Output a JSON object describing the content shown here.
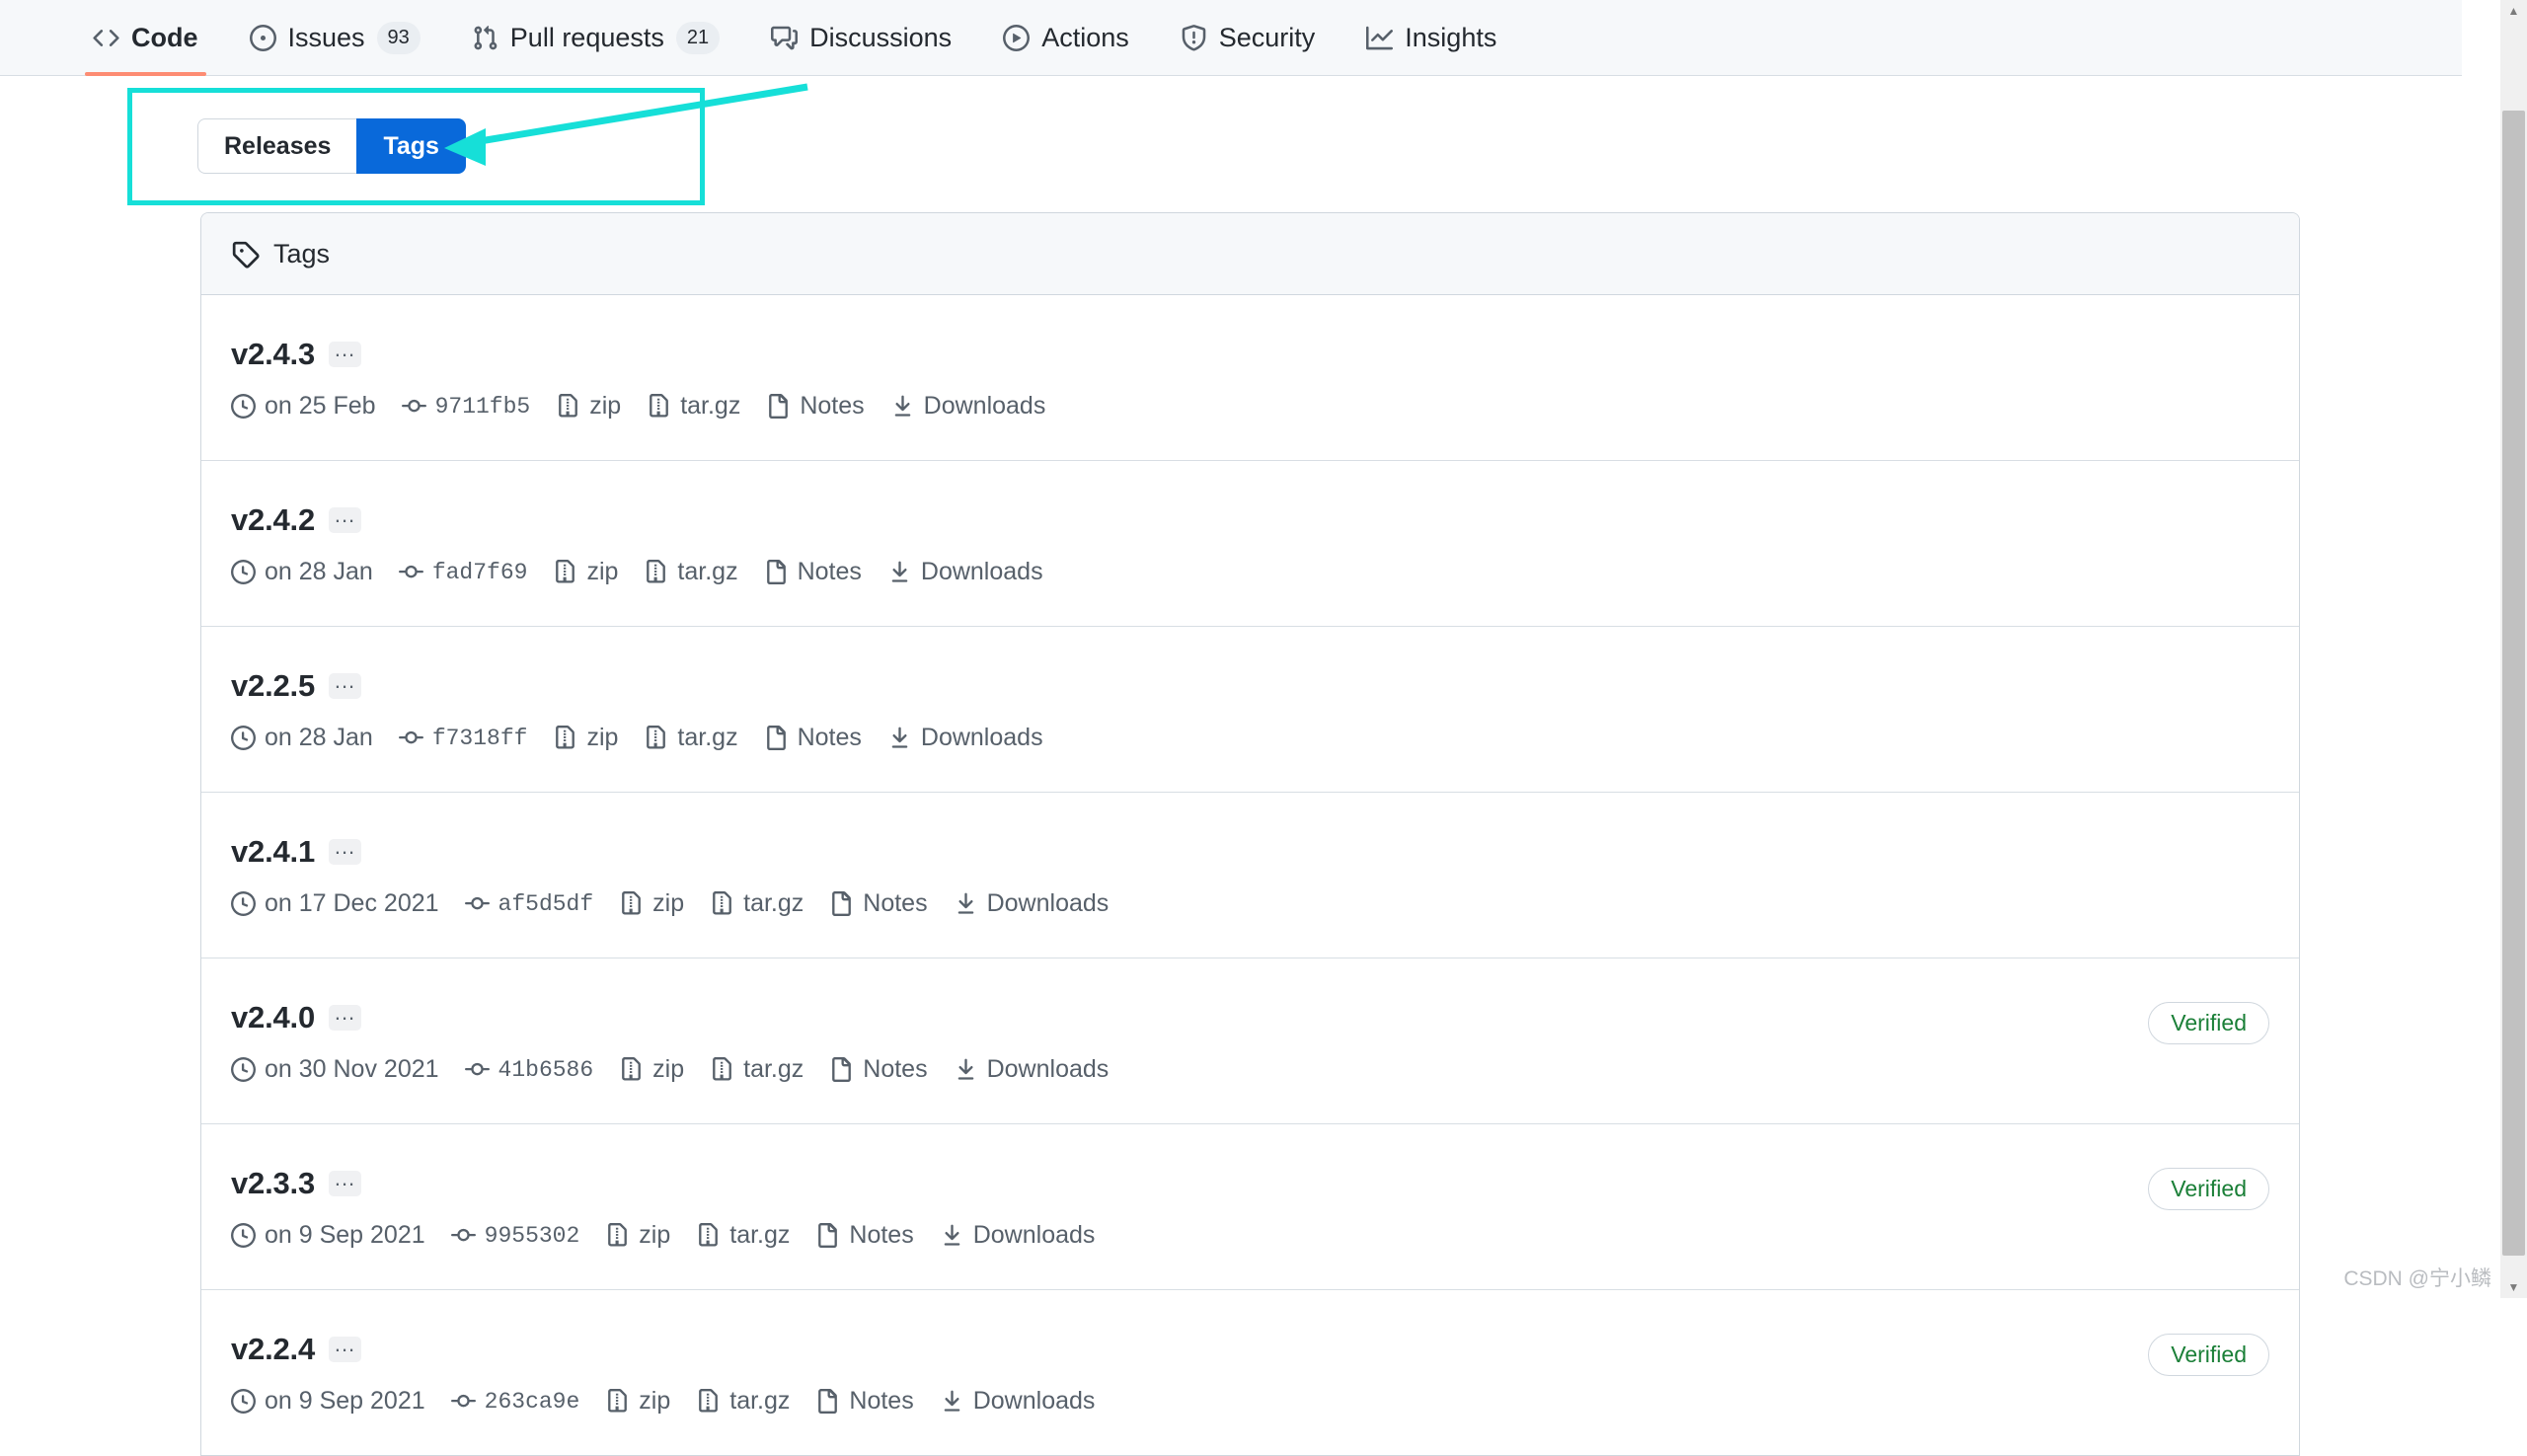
{
  "repo_nav": {
    "items": [
      {
        "label": "Code",
        "icon": "code-icon",
        "count": null,
        "selected": true
      },
      {
        "label": "Issues",
        "icon": "issue-opened-icon",
        "count": "93",
        "selected": false
      },
      {
        "label": "Pull requests",
        "icon": "git-pull-request-icon",
        "count": "21",
        "selected": false
      },
      {
        "label": "Discussions",
        "icon": "comment-discussion-icon",
        "count": null,
        "selected": false
      },
      {
        "label": "Actions",
        "icon": "play-icon",
        "count": null,
        "selected": false
      },
      {
        "label": "Security",
        "icon": "shield-icon",
        "count": null,
        "selected": false
      },
      {
        "label": "Insights",
        "icon": "graph-icon",
        "count": null,
        "selected": false
      }
    ],
    "selected_underline_color": "#fd8c73"
  },
  "toggle": {
    "releases_label": "Releases",
    "tags_label": "Tags",
    "active": "Tags",
    "active_color": "#0969da"
  },
  "annotation": {
    "color": "#16dfd8",
    "shape": "rectangle-with-arrow",
    "points_to": "Tags"
  },
  "panel": {
    "header_label": "Tags",
    "header_icon": "tag-icon",
    "meta_labels": {
      "zip": "zip",
      "targz": "tar.gz",
      "notes": "Notes",
      "downloads": "Downloads"
    },
    "kebab_label": "...",
    "verified_label": "Verified",
    "verified_color": "#1a7f37",
    "rows": [
      {
        "name": "v2.4.3",
        "date": "on 25 Feb",
        "sha": "9711fb5",
        "verified": false
      },
      {
        "name": "v2.4.2",
        "date": "on 28 Jan",
        "sha": "fad7f69",
        "verified": false
      },
      {
        "name": "v2.2.5",
        "date": "on 28 Jan",
        "sha": "f7318ff",
        "verified": false
      },
      {
        "name": "v2.4.1",
        "date": "on 17 Dec 2021",
        "sha": "af5d5df",
        "verified": false
      },
      {
        "name": "v2.4.0",
        "date": "on 30 Nov 2021",
        "sha": "41b6586",
        "verified": true
      },
      {
        "name": "v2.3.3",
        "date": "on 9 Sep 2021",
        "sha": "9955302",
        "verified": true
      },
      {
        "name": "v2.2.4",
        "date": "on 9 Sep 2021",
        "sha": "263ca9e",
        "verified": true
      }
    ]
  },
  "scrollbar": {
    "up_glyph": "▲",
    "down_glyph": "▼"
  },
  "watermark": {
    "text": "CSDN @宁小鳞"
  }
}
